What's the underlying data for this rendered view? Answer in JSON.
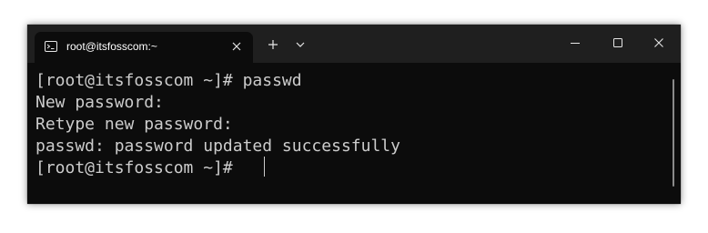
{
  "tab": {
    "title": "root@itsfosscom:~",
    "icon": "terminal-icon"
  },
  "window_controls": [
    "minimize-icon",
    "maximize-icon",
    "close-icon"
  ],
  "terminal": {
    "lines": [
      "[root@itsfosscom ~]# passwd",
      "New password:",
      "Retype new password:",
      "passwd: password updated successfully",
      "[root@itsfosscom ~]#"
    ]
  },
  "colors": {
    "titlebar_bg": "#1f1f1f",
    "terminal_bg": "#0c0c0c",
    "terminal_fg": "#cccccc",
    "tab_fg": "#ffffff"
  }
}
